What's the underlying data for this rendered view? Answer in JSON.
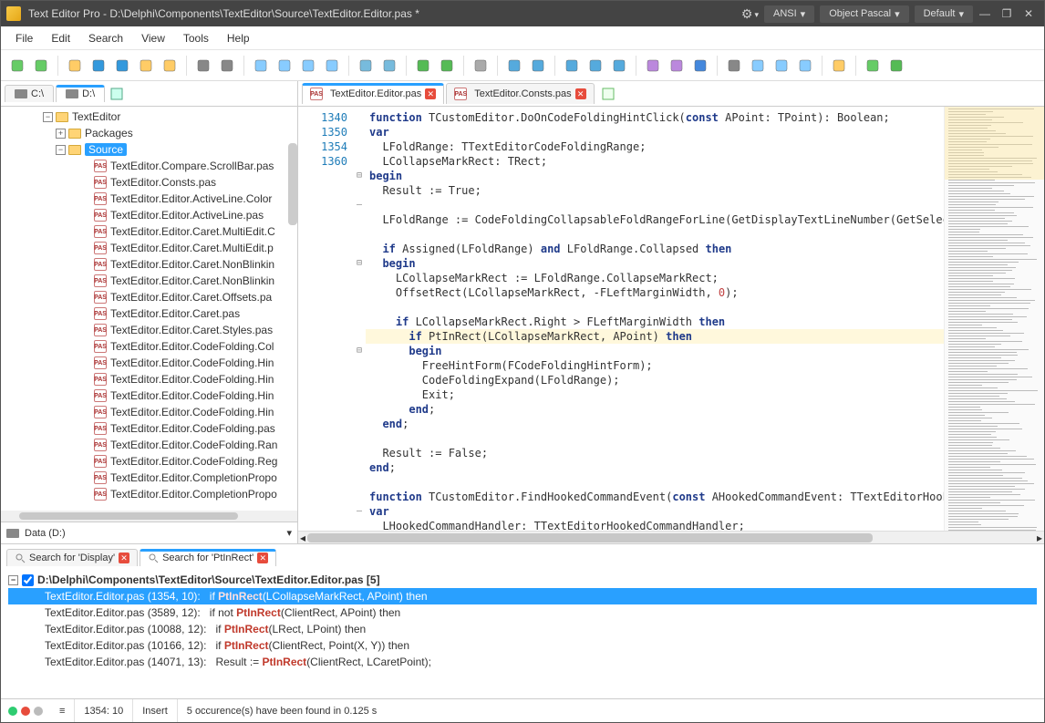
{
  "title": {
    "app": "Text Editor Pro",
    "sep": "  -  ",
    "path": "D:\\Delphi\\Components\\TextEditor\\Source\\TextEditor.Editor.pas *"
  },
  "title_dropdowns": {
    "encoding": "ANSI",
    "language": "Object Pascal",
    "theme": "Default"
  },
  "menus": [
    "File",
    "Edit",
    "Search",
    "View",
    "Tools",
    "Help"
  ],
  "drive_tabs": [
    {
      "label": "C:\\",
      "active": false
    },
    {
      "label": "D:\\",
      "active": true
    }
  ],
  "drive_footer": "Data (D:)",
  "tree": [
    {
      "indent": 3,
      "expander": "-",
      "icon": "folder",
      "label": "TextEditor"
    },
    {
      "indent": 4,
      "expander": "+",
      "icon": "folder",
      "label": "Packages"
    },
    {
      "indent": 4,
      "expander": "-",
      "icon": "folder",
      "label": "Source",
      "selected": true
    },
    {
      "indent": 6,
      "icon": "pas",
      "label": "TextEditor.Compare.ScrollBar.pas"
    },
    {
      "indent": 6,
      "icon": "pas",
      "label": "TextEditor.Consts.pas"
    },
    {
      "indent": 6,
      "icon": "pas",
      "label": "TextEditor.Editor.ActiveLine.Color"
    },
    {
      "indent": 6,
      "icon": "pas",
      "label": "TextEditor.Editor.ActiveLine.pas"
    },
    {
      "indent": 6,
      "icon": "pas",
      "label": "TextEditor.Editor.Caret.MultiEdit.C"
    },
    {
      "indent": 6,
      "icon": "pas",
      "label": "TextEditor.Editor.Caret.MultiEdit.p"
    },
    {
      "indent": 6,
      "icon": "pas",
      "label": "TextEditor.Editor.Caret.NonBlinkin"
    },
    {
      "indent": 6,
      "icon": "pas",
      "label": "TextEditor.Editor.Caret.NonBlinkin"
    },
    {
      "indent": 6,
      "icon": "pas",
      "label": "TextEditor.Editor.Caret.Offsets.pa"
    },
    {
      "indent": 6,
      "icon": "pas",
      "label": "TextEditor.Editor.Caret.pas"
    },
    {
      "indent": 6,
      "icon": "pas",
      "label": "TextEditor.Editor.Caret.Styles.pas"
    },
    {
      "indent": 6,
      "icon": "pas",
      "label": "TextEditor.Editor.CodeFolding.Col"
    },
    {
      "indent": 6,
      "icon": "pas",
      "label": "TextEditor.Editor.CodeFolding.Hin"
    },
    {
      "indent": 6,
      "icon": "pas",
      "label": "TextEditor.Editor.CodeFolding.Hin"
    },
    {
      "indent": 6,
      "icon": "pas",
      "label": "TextEditor.Editor.CodeFolding.Hin"
    },
    {
      "indent": 6,
      "icon": "pas",
      "label": "TextEditor.Editor.CodeFolding.Hin"
    },
    {
      "indent": 6,
      "icon": "pas",
      "label": "TextEditor.Editor.CodeFolding.pas"
    },
    {
      "indent": 6,
      "icon": "pas",
      "label": "TextEditor.Editor.CodeFolding.Ran"
    },
    {
      "indent": 6,
      "icon": "pas",
      "label": "TextEditor.Editor.CodeFolding.Reg"
    },
    {
      "indent": 6,
      "icon": "pas",
      "label": "TextEditor.Editor.CompletionPropo"
    },
    {
      "indent": 6,
      "icon": "pas",
      "label": "TextEditor.Editor.CompletionPropo"
    }
  ],
  "file_tabs": [
    {
      "label": "TextEditor.Editor.pas",
      "active": true,
      "dirty": true
    },
    {
      "label": "TextEditor.Consts.pas",
      "active": false,
      "dirty": false
    }
  ],
  "gutter_lines": [
    "",
    "1340",
    "",
    "",
    "",
    "",
    "",
    "",
    "",
    "",
    "",
    "1350",
    "",
    "",
    "",
    "1354",
    "",
    "",
    "",
    "",
    "",
    "1360",
    "",
    "",
    "",
    "",
    "",
    "",
    "",
    ""
  ],
  "fold_marks": [
    "",
    "",
    "",
    "",
    "⊟",
    "",
    "–",
    "",
    "",
    "",
    "⊟",
    "",
    "",
    "",
    "",
    "",
    "⊟",
    "",
    "",
    "",
    "",
    "",
    "",
    "",
    "",
    "",
    "",
    "–",
    "",
    ""
  ],
  "code_lines": [
    {
      "html": "<span class='kw'>function</span> TCustomEditor.DoOnCodeFoldingHintClick(<span class='kw'>const</span> APoint: TPoint): Boolean;"
    },
    {
      "html": "<span class='kw'>var</span>"
    },
    {
      "html": "  LFoldRange: TTextEditorCodeFoldingRange;"
    },
    {
      "html": "  LCollapseMarkRect: TRect;"
    },
    {
      "html": "<span class='kw'>begin</span>"
    },
    {
      "html": "  Result := True;"
    },
    {
      "html": ""
    },
    {
      "html": "  LFoldRange := CodeFoldingCollapsableFoldRangeForLine(GetDisplayTextLineNumber(GetSelec"
    },
    {
      "html": ""
    },
    {
      "html": "  <span class='kw'>if</span> Assigned(LFoldRange) <span class='kw'>and</span> LFoldRange.Collapsed <span class='kw'>then</span>"
    },
    {
      "html": "  <span class='kw'>begin</span>"
    },
    {
      "html": "    LCollapseMarkRect := LFoldRange.CollapseMarkRect;"
    },
    {
      "html": "    OffsetRect(LCollapseMarkRect, -FLeftMarginWidth, <span class='num'>0</span>);"
    },
    {
      "html": ""
    },
    {
      "html": "    <span class='kw'>if</span> LCollapseMarkRect.Right &gt; FLeftMarginWidth <span class='kw'>then</span>"
    },
    {
      "html": "      <span class='kw'>if</span> PtInRect(LCollapseMarkRect, APoint) <span class='kw'>then</span>",
      "hl": true
    },
    {
      "html": "      <span class='kw'>begin</span>"
    },
    {
      "html": "        FreeHintForm(FCodeFoldingHintForm);"
    },
    {
      "html": "        CodeFoldingExpand(LFoldRange);"
    },
    {
      "html": "        Exit;"
    },
    {
      "html": "      <span class='kw'>end</span>;"
    },
    {
      "html": "  <span class='kw'>end</span>;"
    },
    {
      "html": ""
    },
    {
      "html": "  Result := False;"
    },
    {
      "html": "<span class='kw'>end</span>;"
    },
    {
      "html": ""
    },
    {
      "html": "<span class='kw'>function</span> TCustomEditor.FindHookedCommandEvent(<span class='kw'>const</span> AHookedCommandEvent: TTextEditorHook"
    },
    {
      "html": "<span class='kw'>var</span>"
    },
    {
      "html": "  LHookedCommandHandler: TTextEditorHookedCommandHandler;"
    }
  ],
  "search_tabs": [
    {
      "label": "Search for 'Display'",
      "active": false
    },
    {
      "label": "Search for 'PtInRect'",
      "active": true
    }
  ],
  "search_header": "D:\\Delphi\\Components\\TextEditor\\Source\\TextEditor.Editor.pas [5]",
  "search_results": [
    {
      "loc": "TextEditor.Editor.pas (1354, 10):",
      "prefix": "      if ",
      "term": "PtInRect",
      "suffix": "(LCollapseMarkRect, APoint) then",
      "selected": true
    },
    {
      "loc": "TextEditor.Editor.pas (3589, 12):",
      "prefix": "   if not ",
      "term": "PtInRect",
      "suffix": "(ClientRect, APoint) then"
    },
    {
      "loc": "TextEditor.Editor.pas (10088, 12):",
      "prefix": "      if ",
      "term": "PtInRect",
      "suffix": "(LRect, LPoint) then"
    },
    {
      "loc": "TextEditor.Editor.pas (10166, 12):",
      "prefix": "      if ",
      "term": "PtInRect",
      "suffix": "(ClientRect, Point(X, Y)) then"
    },
    {
      "loc": "TextEditor.Editor.pas (14071, 13):",
      "prefix": "  Result := ",
      "term": "PtInRect",
      "suffix": "(ClientRect, LCaretPoint);"
    }
  ],
  "status": {
    "cursor": "1354: 10",
    "mode": "Insert",
    "message": "5 occurence(s) have been found in 0.125 s"
  }
}
